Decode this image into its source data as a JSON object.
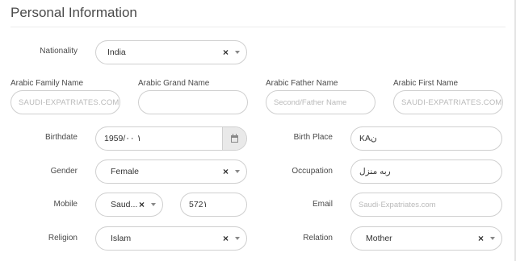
{
  "section": {
    "title": "Personal Information"
  },
  "labels": {
    "nationality": "Nationality",
    "arabic_family_name": "Arabic Family Name",
    "arabic_grand_name": "Arabic Grand Name",
    "arabic_father_name": "Arabic Father Name",
    "arabic_first_name": "Arabic First Name",
    "birthdate": "Birthdate",
    "birth_place": "Birth Place",
    "gender": "Gender",
    "occupation": "Occupation",
    "mobile": "Mobile",
    "email": "Email",
    "religion": "Religion",
    "relation": "Relation"
  },
  "fields": {
    "nationality": {
      "value": "India",
      "clear": "×"
    },
    "arabic_family_name": {
      "value": "",
      "placeholder": "SAUDI-EXPATRIATES.COM"
    },
    "arabic_grand_name": {
      "value": "",
      "placeholder": ""
    },
    "arabic_father_name": {
      "value": "",
      "placeholder": "Second/Father Name"
    },
    "arabic_first_name": {
      "value": "",
      "placeholder": "SAUDI-EXPATRIATES.COM"
    },
    "birthdate": {
      "value": "1959/١ ٠٠"
    },
    "birth_place": {
      "value": "KAن"
    },
    "gender": {
      "value": "Female",
      "clear": "×"
    },
    "occupation": {
      "value": "ربه منزل"
    },
    "mobile_code": {
      "value": "Saud...",
      "clear": "×"
    },
    "mobile_number": {
      "value": "572١"
    },
    "email": {
      "value": "",
      "placeholder": "Saudi-Expatriates.com"
    },
    "religion": {
      "value": "Islam",
      "clear": "×"
    },
    "relation": {
      "value": "Mother",
      "clear": "×"
    }
  },
  "icons": {
    "calendar": "calendar-icon",
    "caret": "chevron-down-icon",
    "clear": "close-icon"
  }
}
